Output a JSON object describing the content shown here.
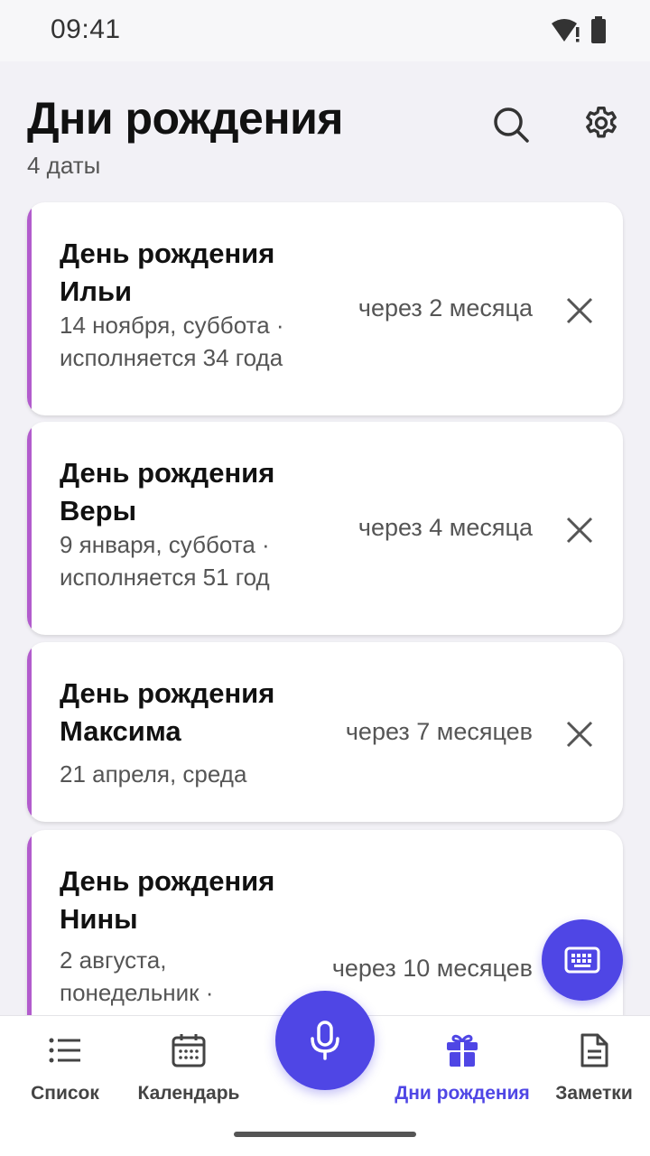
{
  "status": {
    "time": "09:41",
    "icons": [
      "wifi-alert-icon",
      "battery-icon"
    ]
  },
  "header": {
    "title": "Дни рождения",
    "subtitle": "4 даты",
    "actions": [
      "search-icon",
      "gear-icon"
    ]
  },
  "birthdays": [
    {
      "title": "День рождения Ильи",
      "date": "14 ноября, суббота ·",
      "age": "исполняется 34 года",
      "relative": "через 2 месяца"
    },
    {
      "title": "День рождения Веры",
      "date": "9 января, суббота ·",
      "age": "исполняется 51 год",
      "relative": "через 4 месяца"
    },
    {
      "title": "День рождения Максима",
      "date": "21 апреля, среда",
      "relative": "через 7 месяцев"
    },
    {
      "title": "День рождения Нины",
      "date": "2 августа,",
      "date_cont": "понедельник ·",
      "relative": "через 10 месяцев"
    }
  ],
  "fab": {
    "keyboard_icon": "keyboard-icon",
    "mic_icon": "microphone-icon"
  },
  "nav": {
    "items": [
      {
        "label": "Список",
        "icon": "list-icon",
        "active": false
      },
      {
        "label": "Календарь",
        "icon": "calendar-icon",
        "active": false
      },
      {
        "label": "Дни рождения",
        "icon": "gift-icon",
        "active": true
      },
      {
        "label": "Заметки",
        "icon": "note-icon",
        "active": false
      }
    ]
  },
  "colors": {
    "accent": "#4f46e5",
    "card_stripe": "#b25ccd",
    "background": "#f2f1f6"
  }
}
